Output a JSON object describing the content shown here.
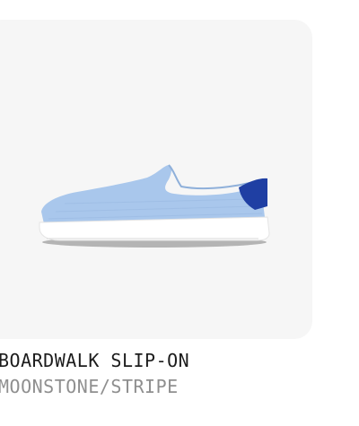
{
  "product": {
    "name": "BOARDWALK SLIP-ON",
    "color": "MOONSTONE/STRIPE",
    "image_alt": "Light blue slip-on sneaker with navy heel tab and white sole"
  },
  "colors": {
    "card_background": "#f6f6f6",
    "shoe_upper": "#a9c7ec",
    "shoe_heel": "#1f3fa3",
    "sole": "#ffffff",
    "name_text": "#1c1c1c",
    "color_text": "#8f8f8f"
  }
}
